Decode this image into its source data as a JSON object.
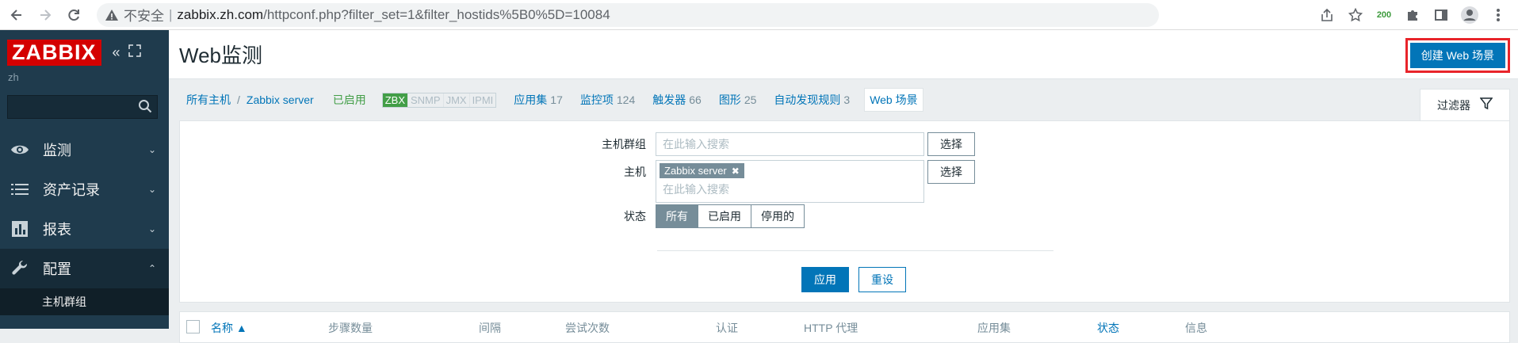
{
  "browser": {
    "insecure_label": "不安全",
    "url_host": "zabbix.zh.com",
    "url_path": "/httpconf.php?filter_set=1&filter_hostids%5B0%5D=10084",
    "ext_badge": "200"
  },
  "sidebar": {
    "logo": "ZABBIX",
    "user": "zh",
    "items": [
      {
        "label": "监测",
        "icon": "eye-icon"
      },
      {
        "label": "资产记录",
        "icon": "list-icon"
      },
      {
        "label": "报表",
        "icon": "bar-chart-icon"
      },
      {
        "label": "配置",
        "icon": "wrench-icon"
      }
    ],
    "sub_items": [
      {
        "label": "主机群组"
      }
    ]
  },
  "header": {
    "title": "Web监测",
    "create_button": "创建 Web 场景"
  },
  "nav": {
    "all_hosts": "所有主机",
    "separator": "/",
    "host": "Zabbix server",
    "enabled": "已启用",
    "protocols": [
      "ZBX",
      "SNMP",
      "JMX",
      "IPMI"
    ],
    "tabs": [
      {
        "label": "应用集",
        "count": "17"
      },
      {
        "label": "监控项",
        "count": "124"
      },
      {
        "label": "触发器",
        "count": "66"
      },
      {
        "label": "图形",
        "count": "25"
      },
      {
        "label": "自动发现规则",
        "count": "3"
      }
    ],
    "current_tab": "Web 场景",
    "filter_tab": "过滤器"
  },
  "filter": {
    "host_group_label": "主机群组",
    "host_group_placeholder": "在此输入搜索",
    "select_label": "选择",
    "host_label": "主机",
    "host_chip": "Zabbix server",
    "host_placeholder": "在此输入搜索",
    "status_label": "状态",
    "status_options": [
      "所有",
      "已启用",
      "停用的"
    ],
    "apply": "应用",
    "reset": "重设"
  },
  "table": {
    "headers": [
      "名称 ▲",
      "步骤数量",
      "间隔",
      "尝试次数",
      "认证",
      "HTTP 代理",
      "应用集",
      "状态",
      "信息"
    ]
  }
}
